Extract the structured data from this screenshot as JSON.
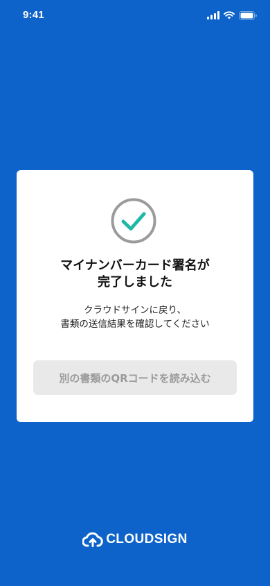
{
  "status_bar": {
    "time": "9:41",
    "icons": [
      "signal-icon",
      "wifi-icon",
      "battery-icon"
    ]
  },
  "dialog": {
    "icon": "check-circle-icon",
    "title_lines": [
      "マイナンバーカード署名が",
      "完了しました"
    ],
    "message_lines": [
      "クラウドサインに戻り、",
      "書類の送信結果を確認してください"
    ],
    "button_label": "別の書類のQRコードを読み込む",
    "button_state": "disabled"
  },
  "footer": {
    "logo_icon": "cloud-upload-icon",
    "brand_name": "CLOUDSIGN"
  },
  "colors": {
    "background": "#0d63c9",
    "card": "#ffffff",
    "check": "#1fb8a6",
    "check_ring": "#9b9b9b",
    "button_bg": "#e9e9e9",
    "button_text": "#9a9a9a"
  }
}
